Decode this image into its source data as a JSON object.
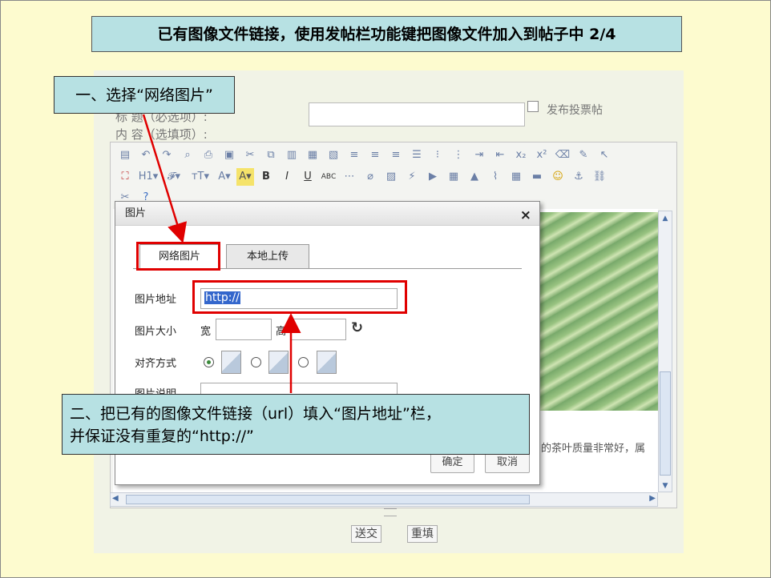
{
  "slide_title": "已有图像文件链接，使用发帖栏功能键把图像文件加入到帖子中 2/4",
  "form": {
    "title_label": "标  题（必选项）:",
    "vote_label": "发布投票帖",
    "content_label": "内  容（选填项）:"
  },
  "editor": {
    "toolbar_row1": [
      "paste-icon",
      "undo-icon",
      "redo-icon",
      "preview-icon",
      "print-icon",
      "template-icon",
      "cut-icon",
      "copy-icon",
      "paste-icon",
      "paste-text-icon",
      "paste-word-icon",
      "align-left-icon",
      "align-center-icon",
      "align-right-icon",
      "justify-icon",
      "ordered-list-icon",
      "unordered-list-icon",
      "indent-icon",
      "outdent-icon",
      "subscript-icon",
      "superscript-icon",
      "clear-format-icon",
      "select-all-icon",
      "cursor-icon"
    ],
    "toolbar_row2": [
      "fullscreen-icon",
      "H1▾",
      "𝓕▾",
      "тT▾",
      "A▾",
      "A▾",
      "B",
      "I",
      "U",
      "ABC",
      "hr-icon",
      "eraser-icon",
      "image-icon",
      "flash-icon",
      "media-icon",
      "table-icon",
      "chart-icon",
      "attachment-icon",
      "grid-icon",
      "insert-icon",
      "smile-icon",
      "anchor-icon",
      "link-icon"
    ],
    "toolbar_row3": [
      "unlink-icon",
      "help-icon"
    ],
    "body_text_fragment": "的茶叶质量非常好，属"
  },
  "dialog": {
    "title": "图片",
    "close_symbol": "×",
    "tabs": [
      {
        "label": "网络图片",
        "active": true
      },
      {
        "label": "本地上传",
        "active": false
      }
    ],
    "url_label": "图片地址",
    "url_value": "http://",
    "size_label": "图片大小",
    "width_label": "宽",
    "height_label": "高",
    "align_label": "对齐方式",
    "desc_label": "图片说明",
    "ok_label": "确定",
    "cancel_label": "取消"
  },
  "page_buttons": {
    "submit_label": "送交",
    "reset_label": "重填"
  },
  "callouts": {
    "step1": "一、选择“网络图片”",
    "step2_line1": "二、把已有的图像文件链接（url）填入“图片地址”栏，",
    "step2_line2": "并保证没有重复的“http://”"
  },
  "colors": {
    "callout_bg": "#b7e1e3",
    "slide_bg": "#fdfbcf",
    "highlight_red": "#e00000",
    "url_selection": "#3366cc"
  }
}
